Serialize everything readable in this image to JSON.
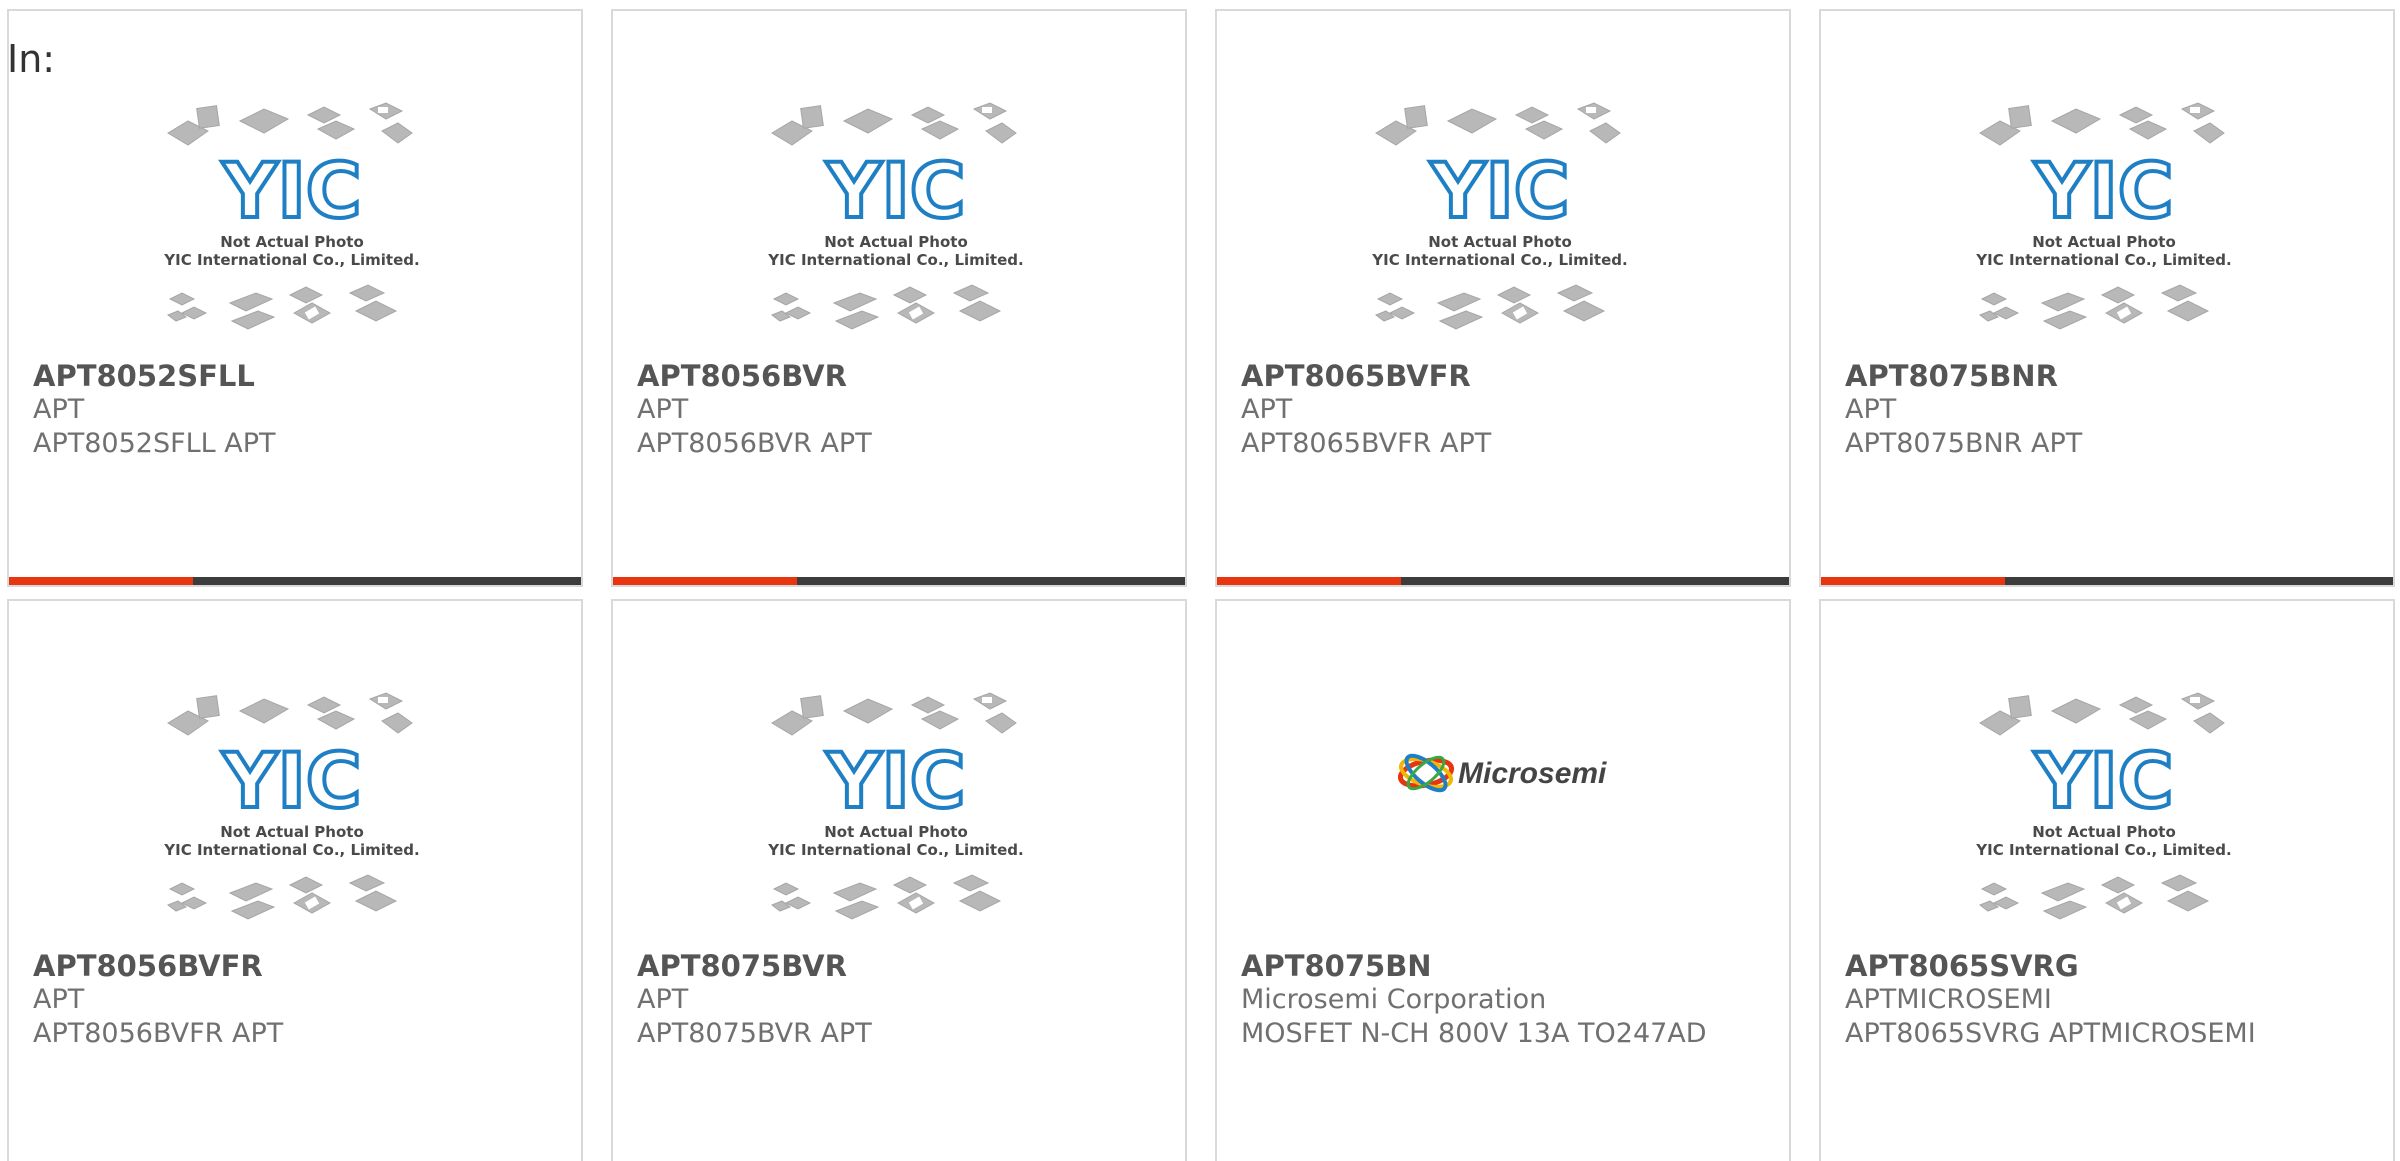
{
  "header": {
    "label": "In:"
  },
  "colors": {
    "accent": "#e8340f",
    "bar": "#3c3c3c",
    "yic_blue": "#1f7fc4",
    "border": "#d9d9d9"
  },
  "placeholder": {
    "line1": "Not Actual Photo",
    "line2": "YIC International Co., Limited.",
    "logo_text": "YIC"
  },
  "microsemi_logo_text": "Microsemi",
  "products": [
    {
      "part": "APT8052SFLL",
      "mfr": "APT",
      "desc": "APT8052SFLL APT",
      "image": "placeholder"
    },
    {
      "part": "APT8056BVR",
      "mfr": "APT",
      "desc": "APT8056BVR APT",
      "image": "placeholder"
    },
    {
      "part": "APT8065BVFR",
      "mfr": "APT",
      "desc": "APT8065BVFR APT",
      "image": "placeholder"
    },
    {
      "part": "APT8075BNR",
      "mfr": "APT",
      "desc": "APT8075BNR APT",
      "image": "placeholder"
    },
    {
      "part": "APT8056BVFR",
      "mfr": "APT",
      "desc": "APT8056BVFR APT",
      "image": "placeholder"
    },
    {
      "part": "APT8075BVR",
      "mfr": "APT",
      "desc": "APT8075BVR APT",
      "image": "placeholder"
    },
    {
      "part": "APT8075BN",
      "mfr": "Microsemi Corporation",
      "desc": "MOSFET N-CH 800V 13A TO247AD",
      "image": "microsemi-logo"
    },
    {
      "part": "APT8065SVRG",
      "mfr": "APTMICROSEMI",
      "desc": "APT8065SVRG APTMICROSEMI",
      "image": "placeholder"
    }
  ]
}
